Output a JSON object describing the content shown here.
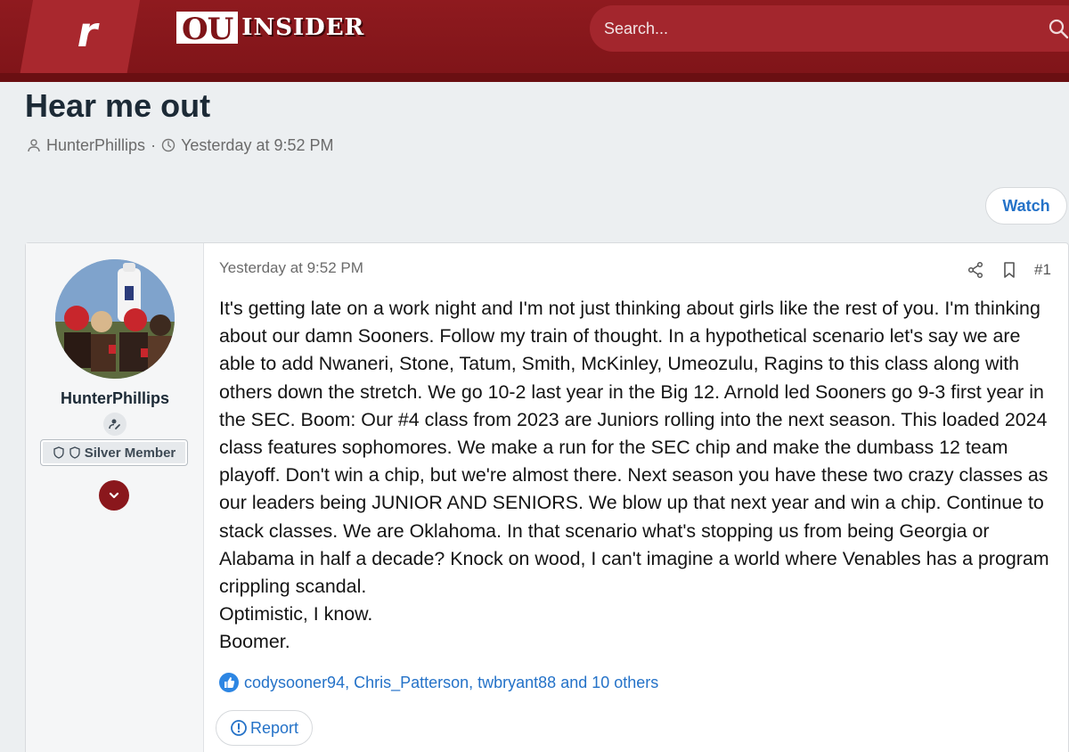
{
  "header": {
    "rivals_logo": "r",
    "site_logo_ou": "OU",
    "site_logo_insider": "INSIDER",
    "search_placeholder": "Search..."
  },
  "thread": {
    "title": "Hear me out",
    "author": "HunterPhillips",
    "separator": "·",
    "date": "Yesterday at 9:52 PM",
    "watch_label": "Watch"
  },
  "post": {
    "user": {
      "name": "HunterPhillips",
      "badge": "Silver Member"
    },
    "date": "Yesterday at 9:52 PM",
    "number": "#1",
    "body": [
      "It's getting late on a work night and I'm not just thinking about girls like the rest of you. I'm thinking about our damn Sooners. Follow my train of thought. In a hypothetical scenario let's say we are able to add Nwaneri, Stone, Tatum, Smith, McKinley, Umeozulu, Ragins to this class along with others down the stretch. We go 10-2 last year in the Big 12. Arnold led Sooners go 9-3 first year in the SEC. Boom: Our #4 class from 2023 are Juniors rolling into the next season. This loaded 2024 class features sophomores. We make a run for the SEC chip and make the dumbass 12 team playoff. Don't win a chip, but we're almost there. Next season you have these two crazy classes as our leaders being JUNIOR AND SENIORS. We blow up that next year and win a chip. Continue to stack classes. We are Oklahoma. In that scenario what's stopping us from being Georgia or Alabama in half a decade? Knock on wood, I can't imagine a world where Venables has a program crippling scandal.",
      "Optimistic, I know.",
      "Boomer."
    ],
    "reactions": "codysooner94, Chris_Patterson, twbryant88 and 10 others",
    "report_label": "Report"
  },
  "colors": {
    "brand": "#8f1a1f",
    "link": "#2472c8"
  }
}
